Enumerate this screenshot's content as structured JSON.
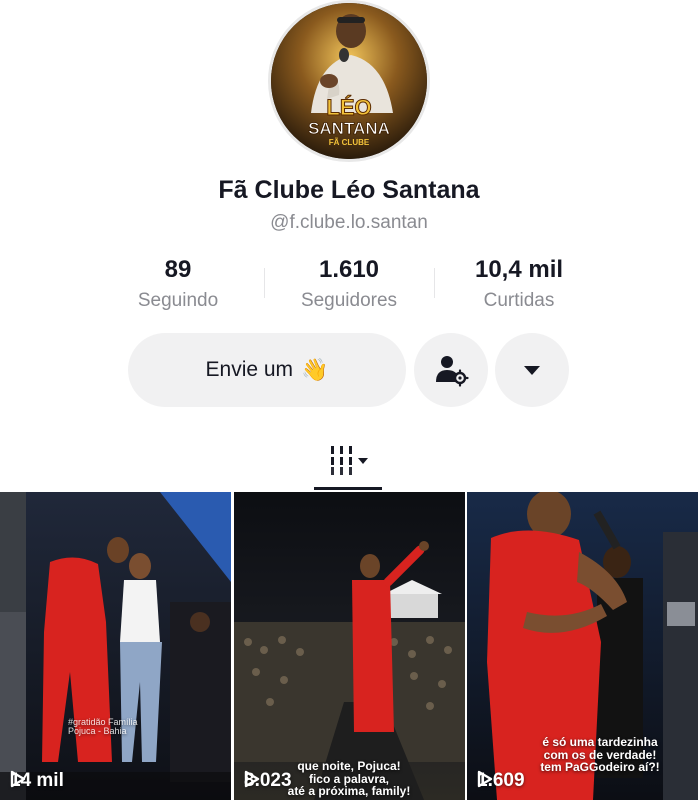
{
  "profile": {
    "avatar_text_line1": "LÉO",
    "avatar_text_line2": "SANTANA",
    "avatar_text_line3": "FÃ CLUBE",
    "name": "Fã Clube Léo Santana",
    "handle": "@f.clube.lo.santan"
  },
  "stats": [
    {
      "value": "89",
      "label": "Seguindo"
    },
    {
      "value": "1.610",
      "label": "Seguidores"
    },
    {
      "value": "10,4 mil",
      "label": "Curtidas"
    }
  ],
  "actions": {
    "message_label": "Envie um",
    "message_emoji": "👋",
    "add_friend_icon": "person-gear-icon",
    "more_icon": "caret-down-icon"
  },
  "tabs": {
    "active_icon": "grid-icon",
    "dropdown_icon": "caret-down-icon"
  },
  "videos": [
    {
      "views": "14 mil",
      "caption": "#gratidão Família\nPojuca - Bahia"
    },
    {
      "views": "8.023",
      "caption": "que noite, Pojuca!\nfico a palavra,\naté a próxima, family!"
    },
    {
      "views": "1.609",
      "caption": "é só uma tardezinha\ncom os de verdade!\ntem PaGGodeiro aí?!"
    }
  ],
  "colors": {
    "accent_red": "#d8231f",
    "gold": "#e8b430",
    "text_primary": "#161823",
    "text_secondary": "#8a8b91",
    "button_bg": "#f1f1f2"
  }
}
